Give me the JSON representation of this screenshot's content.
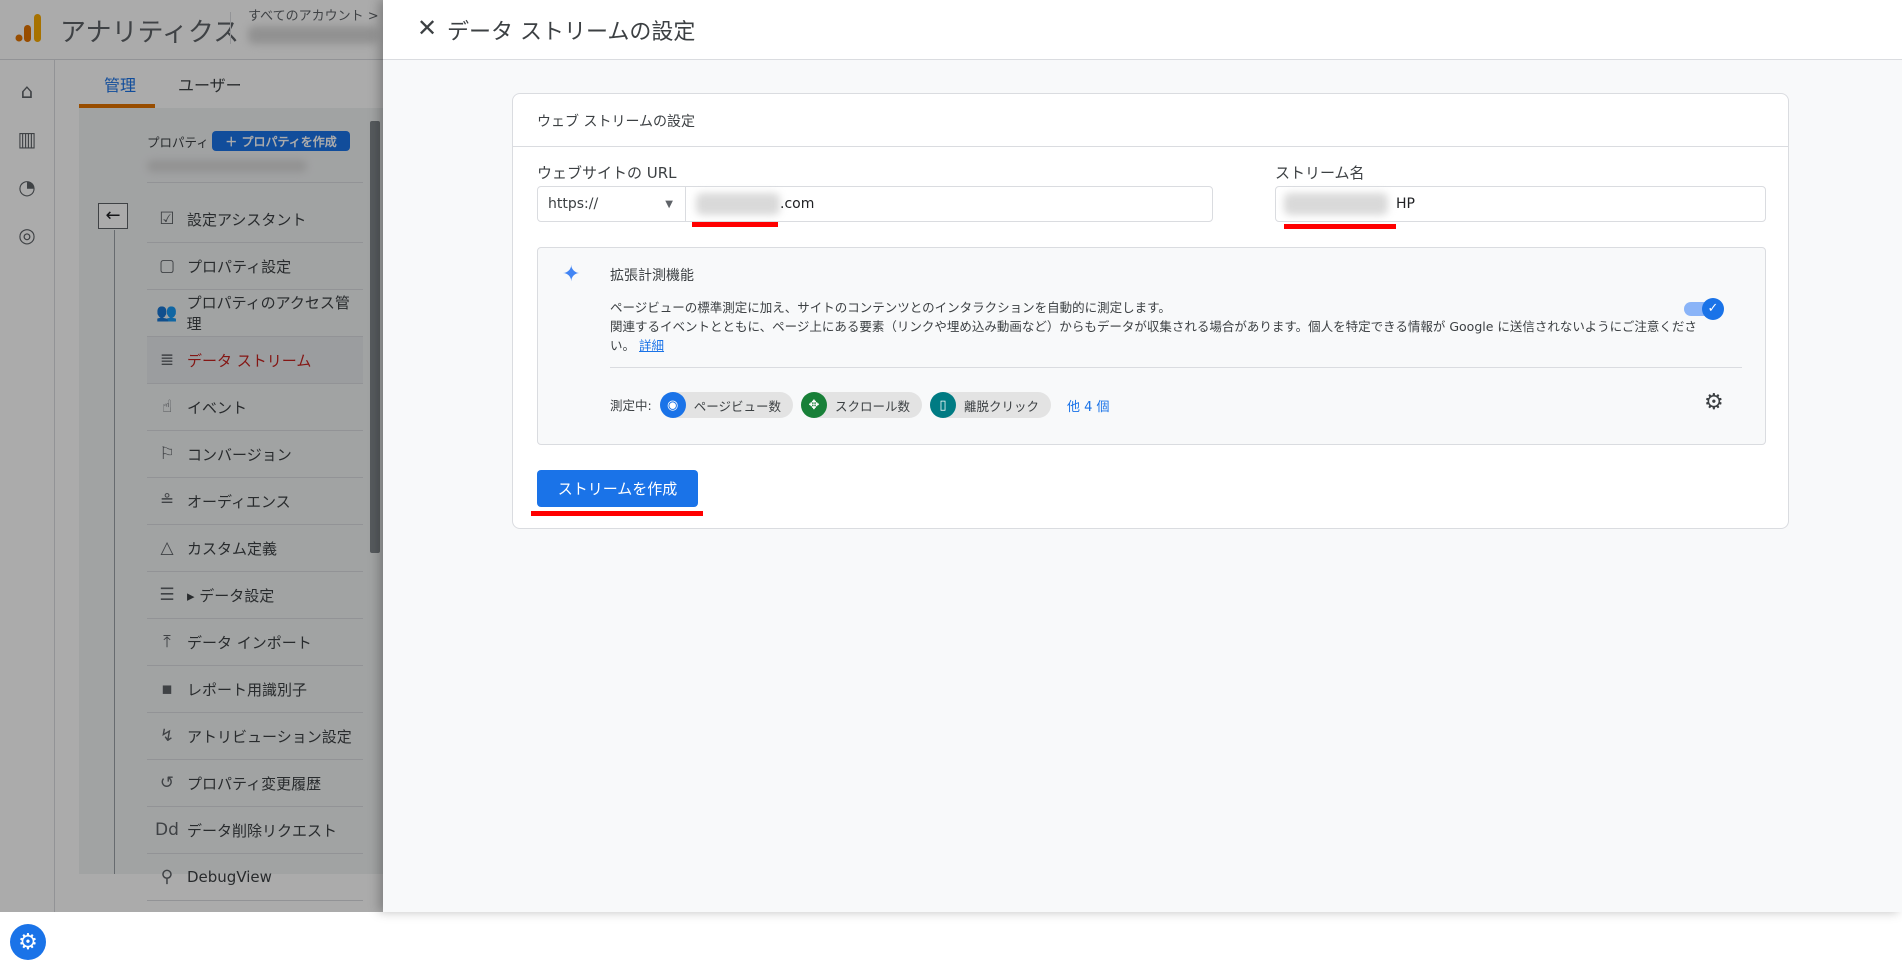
{
  "app": {
    "title": "アナリティクス",
    "breadcrumb": "すべてのアカウント >"
  },
  "tabs": [
    {
      "label": "管理"
    },
    {
      "label": "ユーザー"
    }
  ],
  "property": {
    "label": "プロパティ",
    "create_button": "＋ プロパティを作成"
  },
  "nav": [
    {
      "label": "設定アシスタント",
      "icon": "☑"
    },
    {
      "label": "プロパティ設定",
      "icon": "▢"
    },
    {
      "label": "プロパティのアクセス管理",
      "icon": "👥"
    },
    {
      "label": "データ ストリーム",
      "icon": "≣"
    },
    {
      "label": "イベント",
      "icon": "☝"
    },
    {
      "label": "コンバージョン",
      "icon": "⚐"
    },
    {
      "label": "オーディエンス",
      "icon": "≗"
    },
    {
      "label": "カスタム定義",
      "icon": "△"
    },
    {
      "label": "▸ データ設定",
      "icon": "☰"
    },
    {
      "label": "データ インポート",
      "icon": "⤒"
    },
    {
      "label": "レポート用識別子",
      "icon": "▪"
    },
    {
      "label": "アトリビューション設定",
      "icon": "↯"
    },
    {
      "label": "プロパティ変更履歴",
      "icon": "↺"
    },
    {
      "label": "データ削除リクエスト",
      "icon": "Dd"
    },
    {
      "label": "DebugView",
      "icon": "⚲"
    }
  ],
  "panel": {
    "title": "データ ストリームの設定",
    "card_title": "ウェブ ストリームの設定",
    "url_label": "ウェブサイトの URL",
    "protocol": "https://",
    "url_value": ".com",
    "stream_label": "ストリーム名",
    "stream_value": "HP",
    "enhanced": {
      "title": "拡張計測機能",
      "desc1": "ページビューの標準測定に加え、サイトのコンテンツとのインタラクションを自動的に測定します。",
      "desc2": "関連するイベントとともに、ページ上にある要素（リンクや埋め込み動画など）からもデータが収集される場合があります。個人を特定できる情報が Google に送信されないようにご注意くださ",
      "desc3": "い。",
      "link": "詳細",
      "enabled": true,
      "measuring_label": "測定中:",
      "chips": [
        {
          "label": "ページビュー数",
          "color": "#1a73e8"
        },
        {
          "label": "スクロール数",
          "color": "#188038"
        },
        {
          "label": "離脱クリック",
          "color": "#007b83"
        }
      ],
      "more": "他 4 個"
    },
    "create_button": "ストリームを作成"
  }
}
